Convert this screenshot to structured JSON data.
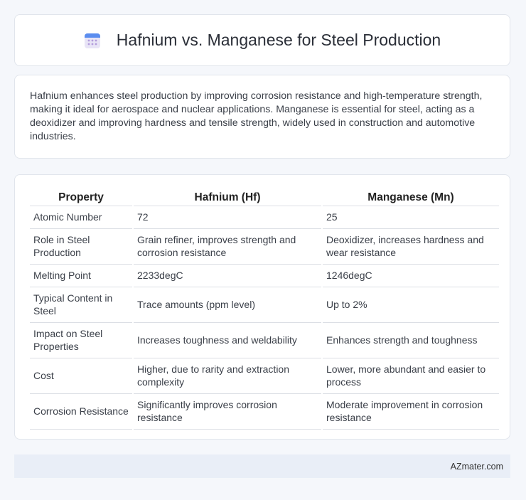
{
  "header": {
    "title": "Hafnium vs. Manganese for Steel Production",
    "icon": "calendar-icon"
  },
  "intro": {
    "text": "Hafnium enhances steel production by improving corrosion resistance and high-temperature strength, making it ideal for aerospace and nuclear applications. Manganese is essential for steel, acting as a deoxidizer and improving hardness and tensile strength, widely used in construction and automotive industries."
  },
  "table": {
    "headers": [
      "Property",
      "Hafnium (Hf)",
      "Manganese (Mn)"
    ],
    "rows": [
      [
        "Atomic Number",
        "72",
        "25"
      ],
      [
        "Role in Steel Production",
        "Grain refiner, improves strength and corrosion resistance",
        "Deoxidizer, increases hardness and wear resistance"
      ],
      [
        "Melting Point",
        "2233degC",
        "1246degC"
      ],
      [
        "Typical Content in Steel",
        "Trace amounts (ppm level)",
        "Up to 2%"
      ],
      [
        "Impact on Steel Properties",
        "Increases toughness and weldability",
        "Enhances strength and toughness"
      ],
      [
        "Cost",
        "Higher, due to rarity and extraction complexity",
        "Lower, more abundant and easier to process"
      ],
      [
        "Corrosion Resistance",
        "Significantly improves corrosion resistance",
        "Moderate improvement in corrosion resistance"
      ]
    ]
  },
  "footer": {
    "site": "AZmater.com"
  },
  "colors": {
    "background": "#f5f7fb",
    "card": "#ffffff",
    "footer_bg": "#e9eef7",
    "icon_blue": "#5b8def",
    "icon_purple": "#b39ddb"
  }
}
